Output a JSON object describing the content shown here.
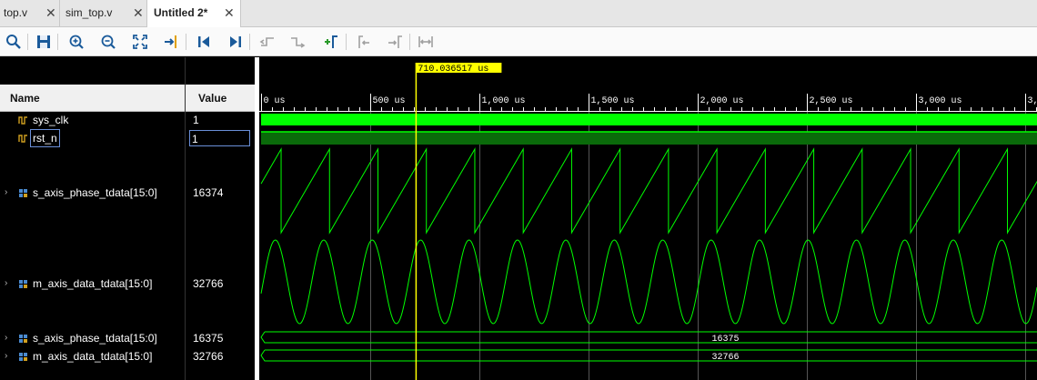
{
  "tabs": [
    {
      "label": "top.v",
      "active": false
    },
    {
      "label": "sim_top.v",
      "active": false
    },
    {
      "label": "Untitled 2*",
      "active": true
    }
  ],
  "toolbar": {
    "icons": [
      "search-icon",
      "save-icon",
      "zoom-in-icon",
      "zoom-out-icon",
      "zoom-fit-icon",
      "go-to-cursor-icon",
      "go-to-time-0-icon",
      "go-to-last-time-icon",
      "previous-transition-icon",
      "next-transition-icon",
      "add-marker-icon",
      "previous-marker-icon",
      "next-marker-icon",
      "swap-cursors-icon"
    ]
  },
  "panel": {
    "name_header": "Name",
    "value_header": "Value"
  },
  "signals": [
    {
      "name": "sys_clk",
      "value": "1",
      "type": "bit",
      "expandable": false
    },
    {
      "name": "rst_n",
      "value": "1",
      "type": "bit",
      "expandable": false,
      "selected": true
    },
    {
      "name": "s_axis_phase_tdata[15:0]",
      "value": "16374",
      "type": "analog-sawtooth",
      "expandable": true
    },
    {
      "name": "m_axis_data_tdata[15:0]",
      "value": "32766",
      "type": "analog-sine",
      "expandable": true
    },
    {
      "name": "s_axis_phase_tdata[15:0]",
      "value": "16375",
      "type": "bus",
      "bus_label": "16375",
      "expandable": true
    },
    {
      "name": "m_axis_data_tdata[15:0]",
      "value": "32766",
      "type": "bus",
      "bus_label": "32766",
      "expandable": true
    }
  ],
  "timeline": {
    "cursor_label": "710.036517 us",
    "cursor_time_us": 710.036517,
    "start_us": 0,
    "major_step_us": 500,
    "ticks": [
      "0 us",
      "500 us",
      "1,000 us",
      "1,500 us",
      "2,000 us",
      "2,500 us",
      "3,000 us",
      "3,"
    ]
  },
  "colors": {
    "wave": "#00ff00",
    "wave_dim": "#0a6a0a",
    "cursor": "#ffff00",
    "grid": "#555555"
  }
}
